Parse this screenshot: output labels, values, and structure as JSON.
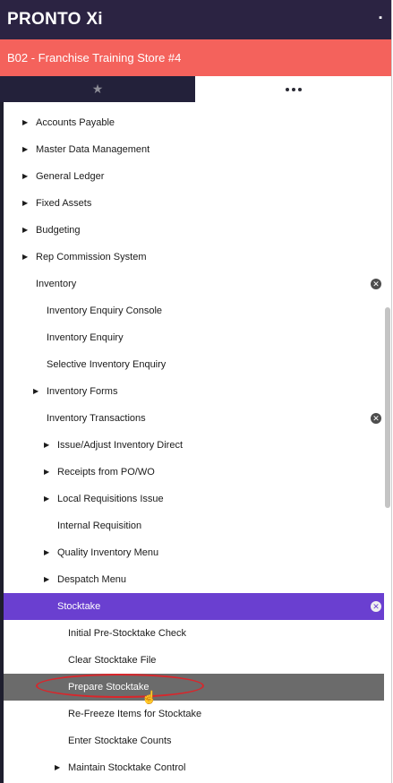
{
  "app": {
    "logo": "PRONTO Xi",
    "pin_glyph": "▪",
    "store": "B02 - Franchise Training Store #4"
  },
  "tabs": {
    "favorites_icon": "star-icon",
    "more_icon": "more-dots-icon"
  },
  "menu": {
    "items": [
      {
        "label": "Accounts Payable",
        "level": 0,
        "expandable": true
      },
      {
        "label": "Master Data Management",
        "level": 0,
        "expandable": true
      },
      {
        "label": "General Ledger",
        "level": 0,
        "expandable": true
      },
      {
        "label": "Fixed Assets",
        "level": 0,
        "expandable": true
      },
      {
        "label": "Budgeting",
        "level": 0,
        "expandable": true
      },
      {
        "label": "Rep Commission System",
        "level": 0,
        "expandable": true
      },
      {
        "label": "Inventory",
        "level": 0,
        "expanded": true
      },
      {
        "label": "Inventory Enquiry Console",
        "level": 1
      },
      {
        "label": "Inventory Enquiry",
        "level": 1
      },
      {
        "label": "Selective Inventory Enquiry",
        "level": 1
      },
      {
        "label": "Inventory Forms",
        "level": 1,
        "expandable": true
      },
      {
        "label": "Inventory Transactions",
        "level": 1,
        "expanded": true
      },
      {
        "label": "Issue/Adjust Inventory Direct",
        "level": 2,
        "expandable": true
      },
      {
        "label": "Receipts from PO/WO",
        "level": 2,
        "expandable": true
      },
      {
        "label": "Local Requisitions Issue",
        "level": 2,
        "expandable": true
      },
      {
        "label": "Internal Requisition",
        "level": 2
      },
      {
        "label": "Quality Inventory Menu",
        "level": 2,
        "expandable": true
      },
      {
        "label": "Despatch Menu",
        "level": 2,
        "expandable": true
      },
      {
        "label": "Stocktake",
        "level": 2,
        "expanded": true,
        "state": "active"
      },
      {
        "label": "Initial Pre-Stocktake Check",
        "level": 3
      },
      {
        "label": "Clear Stocktake File",
        "level": 3
      },
      {
        "label": "Prepare Stocktake",
        "level": 3,
        "state": "hover"
      },
      {
        "label": "Re-Freeze Items for Stocktake",
        "level": 3
      },
      {
        "label": "Enter Stocktake Counts",
        "level": 3
      },
      {
        "label": "Maintain Stocktake Control",
        "level": 3,
        "expandable": true
      }
    ]
  },
  "glyphs": {
    "expand": "▶",
    "collapse": "✕"
  },
  "colors": {
    "header_bg": "#2b2342",
    "store_bar": "#f4625c",
    "active_item": "#6a3fd0",
    "hover_item": "#6b6b6b",
    "annotation_ring": "#d9262b"
  }
}
